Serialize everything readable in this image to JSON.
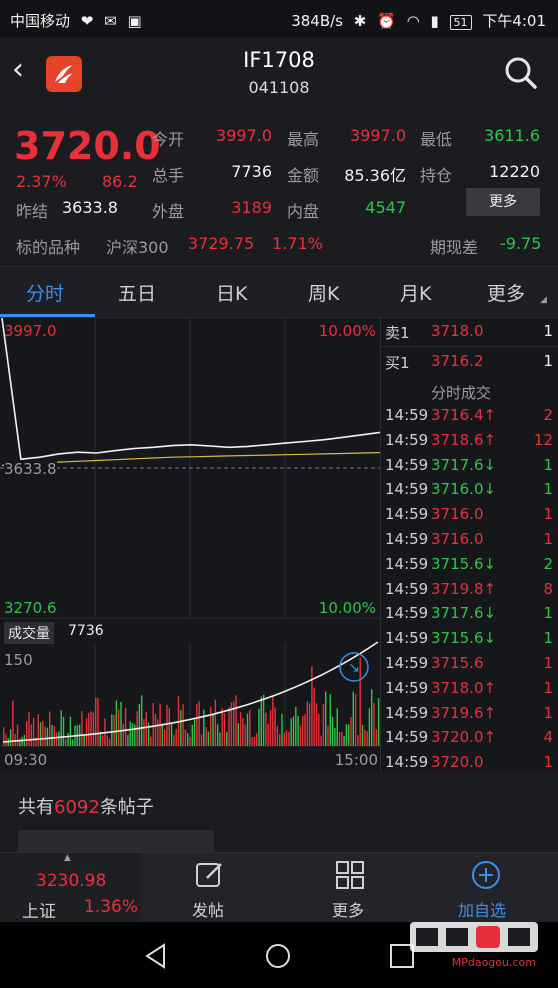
{
  "statusbar": {
    "carrier": "中国移动",
    "speed": "384B/s",
    "battery": "51",
    "time": "下午4:01"
  },
  "header": {
    "title": "IF1708",
    "code": "041108"
  },
  "quote": {
    "price": "3720.0",
    "change_pct": "2.37%",
    "change": "86.2",
    "prev_close_label": "昨结",
    "prev_close": "3633.8",
    "open_label": "今开",
    "open": "3997.0",
    "high_label": "最高",
    "high": "3997.0",
    "low_label": "最低",
    "low": "3611.6",
    "volume_label": "总手",
    "volume": "7736",
    "amount_label": "金额",
    "amount": "85.36亿",
    "oi_label": "持仓",
    "oi": "12220",
    "outer_label": "外盘",
    "outer": "3189",
    "inner_label": "内盘",
    "inner": "4547",
    "more_button": "更多",
    "underlying_label": "标的品种",
    "underlying_name": "沪深300",
    "underlying_price": "3729.75",
    "underlying_pct": "1.71%",
    "basis_label": "期现差",
    "basis": "-9.75"
  },
  "tabs": [
    "分时",
    "五日",
    "日K",
    "周K",
    "月K",
    "更多"
  ],
  "chart": {
    "top_price": "3997.0",
    "top_pct": "10.00%",
    "mid_price": "3633.8",
    "bottom_price": "3270.6",
    "bottom_pct": "10.00%",
    "volume_label": "成交量",
    "volume_value": "7736",
    "vol_axis_max": "150",
    "time_start": "09:30",
    "time_end": "15:00"
  },
  "chart_data": {
    "type": "line",
    "title": "",
    "x": [
      "09:30",
      "15:00"
    ],
    "ylim": [
      3270.6,
      3997.0
    ],
    "reference": 3633.8,
    "series": [
      {
        "values": [
          3997.0,
          3655,
          3660,
          3668,
          3672,
          3670,
          3676,
          3681,
          3684,
          3688,
          3690,
          3687,
          3684,
          3686,
          3690,
          3694,
          3698,
          3702,
          3708,
          3714,
          3720
        ]
      },
      {
        "values": [
          3640,
          3643,
          3646,
          3648,
          3650,
          3652,
          3654,
          3656,
          3658,
          3660,
          3661,
          3662,
          3663,
          3664,
          3665,
          3666,
          3667,
          3668,
          3669,
          3670,
          3671
        ]
      }
    ]
  },
  "orderbook": {
    "ask_label": "卖1",
    "ask_price": "3718.0",
    "ask_vol": "1",
    "bid_label": "买1",
    "bid_price": "3716.2",
    "bid_vol": "1",
    "trades_title": "分时成交",
    "trades": [
      {
        "t": "14:59",
        "p": "3716.4↑",
        "v": "2",
        "c": "red"
      },
      {
        "t": "14:59",
        "p": "3718.6↑",
        "v": "12",
        "c": "red"
      },
      {
        "t": "14:59",
        "p": "3717.6↓",
        "v": "1",
        "c": "green"
      },
      {
        "t": "14:59",
        "p": "3716.0↓",
        "v": "1",
        "c": "green"
      },
      {
        "t": "14:59",
        "p": "3716.0",
        "v": "1",
        "c": "red"
      },
      {
        "t": "14:59",
        "p": "3716.0",
        "v": "1",
        "c": "red"
      },
      {
        "t": "14:59",
        "p": "3715.6↓",
        "v": "2",
        "c": "green"
      },
      {
        "t": "14:59",
        "p": "3719.8↑",
        "v": "8",
        "c": "red"
      },
      {
        "t": "14:59",
        "p": "3717.6↓",
        "v": "1",
        "c": "green"
      },
      {
        "t": "14:59",
        "p": "3715.6↓",
        "v": "1",
        "c": "green"
      },
      {
        "t": "14:59",
        "p": "3715.6",
        "v": "1",
        "c": "red"
      },
      {
        "t": "14:59",
        "p": "3718.0↑",
        "v": "1",
        "c": "red"
      },
      {
        "t": "14:59",
        "p": "3719.6↑",
        "v": "1",
        "c": "red"
      },
      {
        "t": "14:59",
        "p": "3720.0↑",
        "v": "4",
        "c": "red"
      },
      {
        "t": "14:59",
        "p": "3720.0",
        "v": "1",
        "c": "red"
      }
    ]
  },
  "posts": {
    "prefix": "共有",
    "count": "6092",
    "suffix": "条帖子"
  },
  "bottom_nav": {
    "index_price": "3230.98",
    "index_name": "上证",
    "index_pct": "1.36%",
    "post": "发帖",
    "more": "更多",
    "add_watch": "加自选"
  },
  "watermark": {
    "text": "MPdaogou.com"
  },
  "colors": {
    "up": "#e8303a",
    "down": "#2fc44a",
    "accent": "#3a8fe8"
  }
}
